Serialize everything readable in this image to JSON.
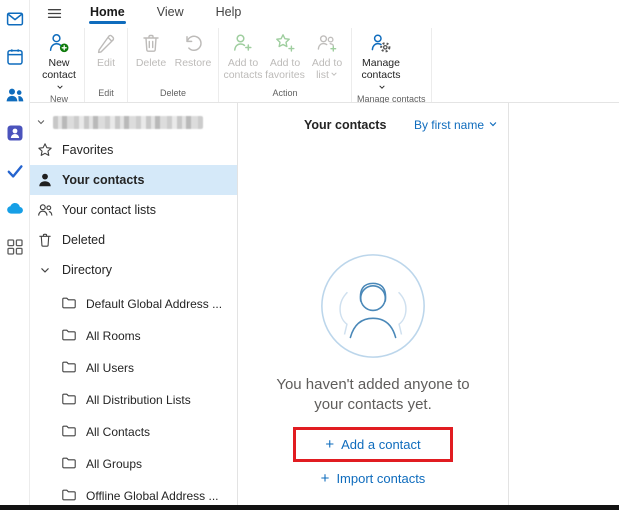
{
  "app_rail": {
    "icons": [
      {
        "name": "outlook-mail"
      },
      {
        "name": "calendar"
      },
      {
        "name": "people",
        "active": true
      },
      {
        "name": "groups"
      },
      {
        "name": "todo"
      },
      {
        "name": "onedrive"
      },
      {
        "name": "more-apps"
      }
    ]
  },
  "menu": {
    "tabs": [
      {
        "label": "Home",
        "active": true
      },
      {
        "label": "View",
        "active": false
      },
      {
        "label": "Help",
        "active": false
      }
    ]
  },
  "ribbon": {
    "groups": [
      {
        "label": "New",
        "buttons": [
          {
            "label": "New contact",
            "enabled": true,
            "dropdown": true
          }
        ]
      },
      {
        "label": "Edit",
        "buttons": [
          {
            "label": "Edit",
            "enabled": false,
            "dropdown": false
          }
        ]
      },
      {
        "label": "Delete",
        "buttons": [
          {
            "label": "Delete",
            "enabled": false,
            "dropdown": false
          },
          {
            "label": "Restore",
            "enabled": false,
            "dropdown": false
          }
        ]
      },
      {
        "label": "Action",
        "buttons": [
          {
            "label": "Add to contacts",
            "enabled": false,
            "dropdown": false
          },
          {
            "label": "Add to favorites",
            "enabled": false,
            "dropdown": false
          },
          {
            "label": "Add to list",
            "enabled": false,
            "dropdown": true
          }
        ]
      },
      {
        "label": "Manage contacts",
        "buttons": [
          {
            "label": "Manage contacts",
            "enabled": true,
            "dropdown": true
          }
        ]
      }
    ]
  },
  "sidebar": {
    "account": {
      "redacted": true
    },
    "items": [
      {
        "label": "Favorites",
        "icon": "star",
        "selected": false
      },
      {
        "label": "Your contacts",
        "icon": "person",
        "selected": true
      },
      {
        "label": "Your contact lists",
        "icon": "people",
        "selected": false
      },
      {
        "label": "Deleted",
        "icon": "trash",
        "selected": false
      }
    ],
    "directory": {
      "label": "Directory",
      "expanded": true,
      "folders": [
        {
          "label": "Default Global Address ..."
        },
        {
          "label": "All Rooms"
        },
        {
          "label": "All Users"
        },
        {
          "label": "All Distribution Lists"
        },
        {
          "label": "All Contacts"
        },
        {
          "label": "All Groups"
        },
        {
          "label": "Offline Global Address ..."
        }
      ]
    }
  },
  "list_pane": {
    "title": "Your contacts",
    "sort": {
      "label": "By first name",
      "dropdown": true
    },
    "empty_state": {
      "message_line1": "You haven't added anyone to",
      "message_line2": "your contacts yet.",
      "add_contact_label": "Add a contact",
      "import_contacts_label": "Import contacts"
    }
  },
  "annotations": {
    "highlight_box_target": "Add a contact",
    "highlight_color": "#e11c21"
  },
  "colors": {
    "accent_blue": "#0f6cbd",
    "selected_nav_bg": "#d5e9f9",
    "disabled_text": "#bdbbb9",
    "ribbon_group_label": "#616161"
  }
}
